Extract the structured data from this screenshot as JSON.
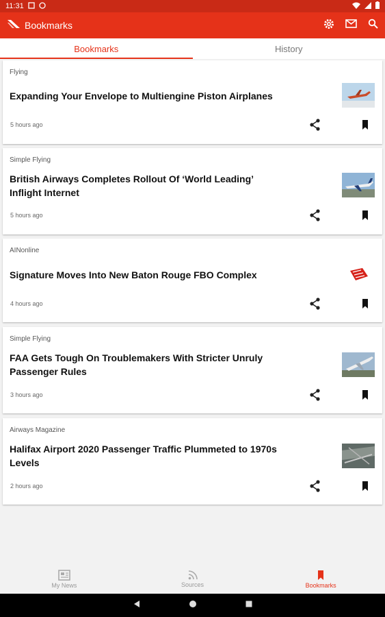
{
  "status": {
    "time": "11:31"
  },
  "appbar": {
    "title": "Bookmarks"
  },
  "tabs": [
    {
      "label": "Bookmarks"
    },
    {
      "label": "History"
    }
  ],
  "articles": [
    {
      "source": "Flying",
      "title": "Expanding Your Envelope to Multiengine Piston Airplanes",
      "time": "5 hours ago",
      "thumb": "plane-sky"
    },
    {
      "source": "Simple Flying",
      "title": "British Airways Completes Rollout Of ‘World Leading’ Inflight Internet",
      "time": "5 hours ago",
      "thumb": "plane-ground"
    },
    {
      "source": "AINonline",
      "title": "Signature Moves Into New Baton Rouge FBO Complex",
      "time": "4 hours ago",
      "thumb": "red-logo"
    },
    {
      "source": "Simple Flying",
      "title": "FAA Gets Tough On Troublemakers With Stricter Unruly Passenger Rules",
      "time": "3 hours ago",
      "thumb": "plane-takeoff"
    },
    {
      "source": "Airways Magazine",
      "title": "Halifax Airport 2020 Passenger Traffic Plummeted to 1970s Levels",
      "time": "2 hours ago",
      "thumb": "airport-aerial"
    }
  ],
  "bottomnav": [
    {
      "label": "My News"
    },
    {
      "label": "Sources"
    },
    {
      "label": "Bookmarks"
    }
  ],
  "colors": {
    "primary": "#e53219",
    "statusbar": "#c92a16"
  }
}
